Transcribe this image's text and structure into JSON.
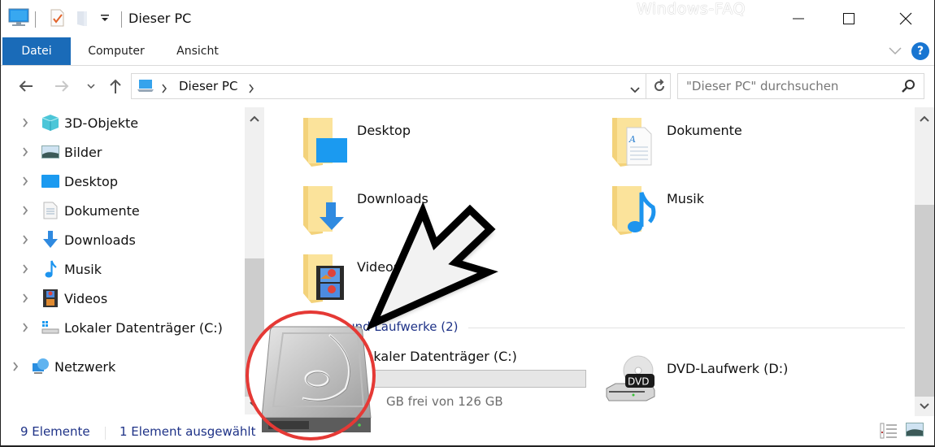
{
  "window": {
    "title": "Dieser PC",
    "watermark": "Windows-FAQ",
    "controls": {
      "minimize": "minimize",
      "maximize": "maximize",
      "close": "close"
    }
  },
  "quick_access": {
    "icons": [
      "this-pc-icon",
      "properties-icon",
      "new-folder-icon",
      "customize-dropdown-icon"
    ]
  },
  "ribbon": {
    "tabs": [
      {
        "label": "Datei",
        "active": true
      },
      {
        "label": "Computer",
        "active": false
      },
      {
        "label": "Ansicht",
        "active": false
      }
    ],
    "help_label": "?"
  },
  "navigation": {
    "back": "back-arrow",
    "forward": "forward-arrow",
    "recent": "recent-locations",
    "up": "up-arrow",
    "breadcrumb": [
      "Dieser PC"
    ],
    "search_placeholder": "\"Dieser PC\" durchsuchen"
  },
  "sidebar": {
    "items": [
      {
        "label": "3D-Objekte",
        "icon": "3d-objects-icon"
      },
      {
        "label": "Bilder",
        "icon": "pictures-icon"
      },
      {
        "label": "Desktop",
        "icon": "desktop-icon"
      },
      {
        "label": "Dokumente",
        "icon": "documents-icon"
      },
      {
        "label": "Downloads",
        "icon": "downloads-icon"
      },
      {
        "label": "Musik",
        "icon": "music-icon"
      },
      {
        "label": "Videos",
        "icon": "videos-icon"
      },
      {
        "label": "Lokaler Datenträger (C:)",
        "icon": "local-disk-icon"
      },
      {
        "label": "Netzwerk",
        "icon": "network-icon"
      }
    ]
  },
  "content": {
    "folders": [
      {
        "label": "Desktop",
        "icon": "desktop-folder-icon"
      },
      {
        "label": "Dokumente",
        "icon": "documents-folder-icon"
      },
      {
        "label": "Downloads",
        "icon": "downloads-folder-icon"
      },
      {
        "label": "Musik",
        "icon": "music-folder-icon"
      },
      {
        "label": "Videos",
        "icon": "videos-folder-icon"
      }
    ],
    "drives_section": "Geräte und Laufwerke (2)",
    "drives": [
      {
        "label": "Lokaler Datenträger (C:)",
        "icon": "hard-drive-icon",
        "free_text": "GB frei von 126 GB",
        "used_fraction": 0.0
      },
      {
        "label": "DVD-Laufwerk (D:)",
        "icon": "dvd-drive-icon"
      }
    ]
  },
  "status": {
    "item_count": "9 Elemente",
    "selection": "1 Element ausgewählt"
  },
  "annotation": {
    "arrow": "pointer-arrow",
    "highlight": "red-circle-hard-drive",
    "color": "#e53935"
  }
}
